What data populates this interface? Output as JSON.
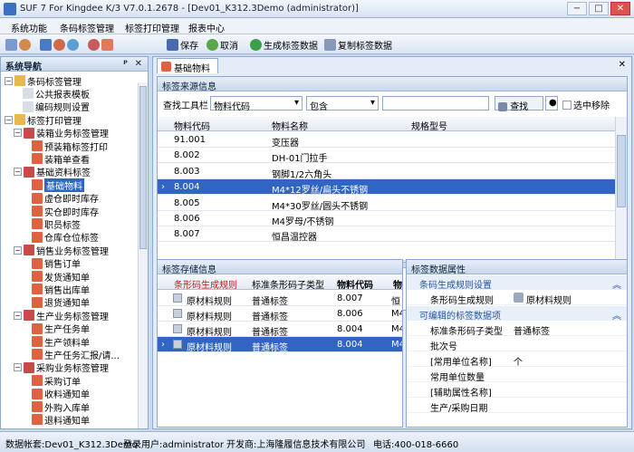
{
  "window": {
    "title": "SUF 7 For Kingdee K/3 V7.0.1.2678 - [Dev01_K312.3Demo (administrator)]",
    "min": "−",
    "max": "□",
    "close": "✕"
  },
  "menu": [
    "系统功能",
    "条码标签管理",
    "标签打印管理",
    "报表中心"
  ],
  "toolbar": {
    "save": "保存",
    "cancel": "取消",
    "generate": "生成标签数据",
    "copy": "复制标签数据"
  },
  "nav": {
    "title": "系统导航",
    "pin": "ᵖ",
    "close": "✕",
    "nodes": [
      {
        "label": "条码标签管理",
        "exp": "−",
        "level": 0,
        "icon": "#e8b84a"
      },
      {
        "label": "公共报表模板",
        "level": 2,
        "icon": "#d9dee6"
      },
      {
        "label": "编码规则设置",
        "level": 2,
        "icon": "#d9dee6"
      },
      {
        "label": "标签打印管理",
        "exp": "−",
        "level": 0,
        "icon": "#e8b84a"
      },
      {
        "label": "装箱业务标签管理",
        "exp": "−",
        "level": 1,
        "icon": "#c84a4a"
      },
      {
        "label": "预装箱标签打印",
        "level": 3,
        "icon": "#e06040"
      },
      {
        "label": "装箱单查看",
        "level": 3,
        "icon": "#e06040"
      },
      {
        "label": "基础资料标签",
        "exp": "−",
        "level": 1,
        "icon": "#c84a4a"
      },
      {
        "label": "基础物料",
        "level": 3,
        "icon": "#e06040",
        "selected": true
      },
      {
        "label": "虚仓即时库存",
        "level": 3,
        "icon": "#e06040"
      },
      {
        "label": "实仓即时库存",
        "level": 3,
        "icon": "#e06040"
      },
      {
        "label": "职员标签",
        "level": 3,
        "icon": "#e06040"
      },
      {
        "label": "仓库仓位标签",
        "level": 3,
        "icon": "#e06040"
      },
      {
        "label": "销售业务标签管理",
        "exp": "−",
        "level": 1,
        "icon": "#c84a4a"
      },
      {
        "label": "销售订单",
        "level": 3,
        "icon": "#e06040"
      },
      {
        "label": "发货通知单",
        "level": 3,
        "icon": "#e06040"
      },
      {
        "label": "销售出库单",
        "level": 3,
        "icon": "#e06040"
      },
      {
        "label": "退货通知单",
        "level": 3,
        "icon": "#e06040"
      },
      {
        "label": "生产业务标签管理",
        "exp": "−",
        "level": 1,
        "icon": "#c84a4a"
      },
      {
        "label": "生产任务单",
        "level": 3,
        "icon": "#e06040"
      },
      {
        "label": "生产领料单",
        "level": 3,
        "icon": "#e06040"
      },
      {
        "label": "生产任务汇报/请...",
        "level": 3,
        "icon": "#e06040"
      },
      {
        "label": "采购业务标签管理",
        "exp": "−",
        "level": 1,
        "icon": "#c84a4a"
      },
      {
        "label": "采购订单",
        "level": 3,
        "icon": "#e06040"
      },
      {
        "label": "收料通知单",
        "level": 3,
        "icon": "#e06040"
      },
      {
        "label": "外购入库单",
        "level": 3,
        "icon": "#e06040"
      },
      {
        "label": "退料通知单",
        "level": 3,
        "icon": "#e06040"
      }
    ]
  },
  "doc_tab": {
    "label": "基础物料",
    "close": "✕"
  },
  "source": {
    "title": "标签来源信息",
    "search_label": "查找工具栏",
    "field": "物料代码",
    "op": "包含",
    "value": "",
    "find": "查找",
    "remove": "选中移除",
    "cols": [
      "物料代码",
      "物料名称",
      "规格型号"
    ],
    "rows": [
      [
        "91.001",
        "变压器",
        ""
      ],
      [
        "8.002",
        "DH-01门拉手",
        ""
      ],
      [
        "8.003",
        "钢脚1/2六角头",
        ""
      ],
      [
        "8.004",
        "M4*12罗丝/扁头不锈钢",
        ""
      ],
      [
        "8.005",
        "M4*30罗丝/圆头不锈钢",
        ""
      ],
      [
        "8.006",
        "M4罗母/不锈钢",
        ""
      ],
      [
        "8.007",
        "恒昌温控器",
        ""
      ]
    ],
    "selected": 3
  },
  "store": {
    "title": "标签存储信息",
    "cols": [
      "条形码生成规则",
      "标准条形码子类型",
      "物料代码",
      "物"
    ],
    "rows": [
      [
        "原材料规则",
        "普通标签",
        "8.007",
        "恒"
      ],
      [
        "原材料规则",
        "普通标签",
        "8.006",
        "M4"
      ],
      [
        "原材料规则",
        "普通标签",
        "8.004",
        "M4"
      ],
      [
        "原材料规则",
        "普通标签",
        "8.004",
        "M4"
      ]
    ],
    "selected": 3
  },
  "props": {
    "title": "标签数据属性",
    "sec1": "条码生成规则设置",
    "rule_label": "条形码生成规则",
    "rule_value": "原材料规则",
    "sec2": "可编辑的标签数据项",
    "items": [
      [
        "标准条形码子类型",
        "普通标签"
      ],
      [
        "批次号",
        ""
      ],
      [
        "[常用单位名称]",
        "个"
      ],
      [
        "常用单位数量",
        ""
      ],
      [
        "[辅助属性名称]",
        ""
      ],
      [
        "生产/采购日期",
        ""
      ]
    ]
  },
  "status": {
    "account": "数据帐套:Dev01_K312.3Demo",
    "user": "登录用户:administrator",
    "dev": "开发商:上海隆履信息技术有限公司",
    "phone": "电话:400-018-6660"
  }
}
